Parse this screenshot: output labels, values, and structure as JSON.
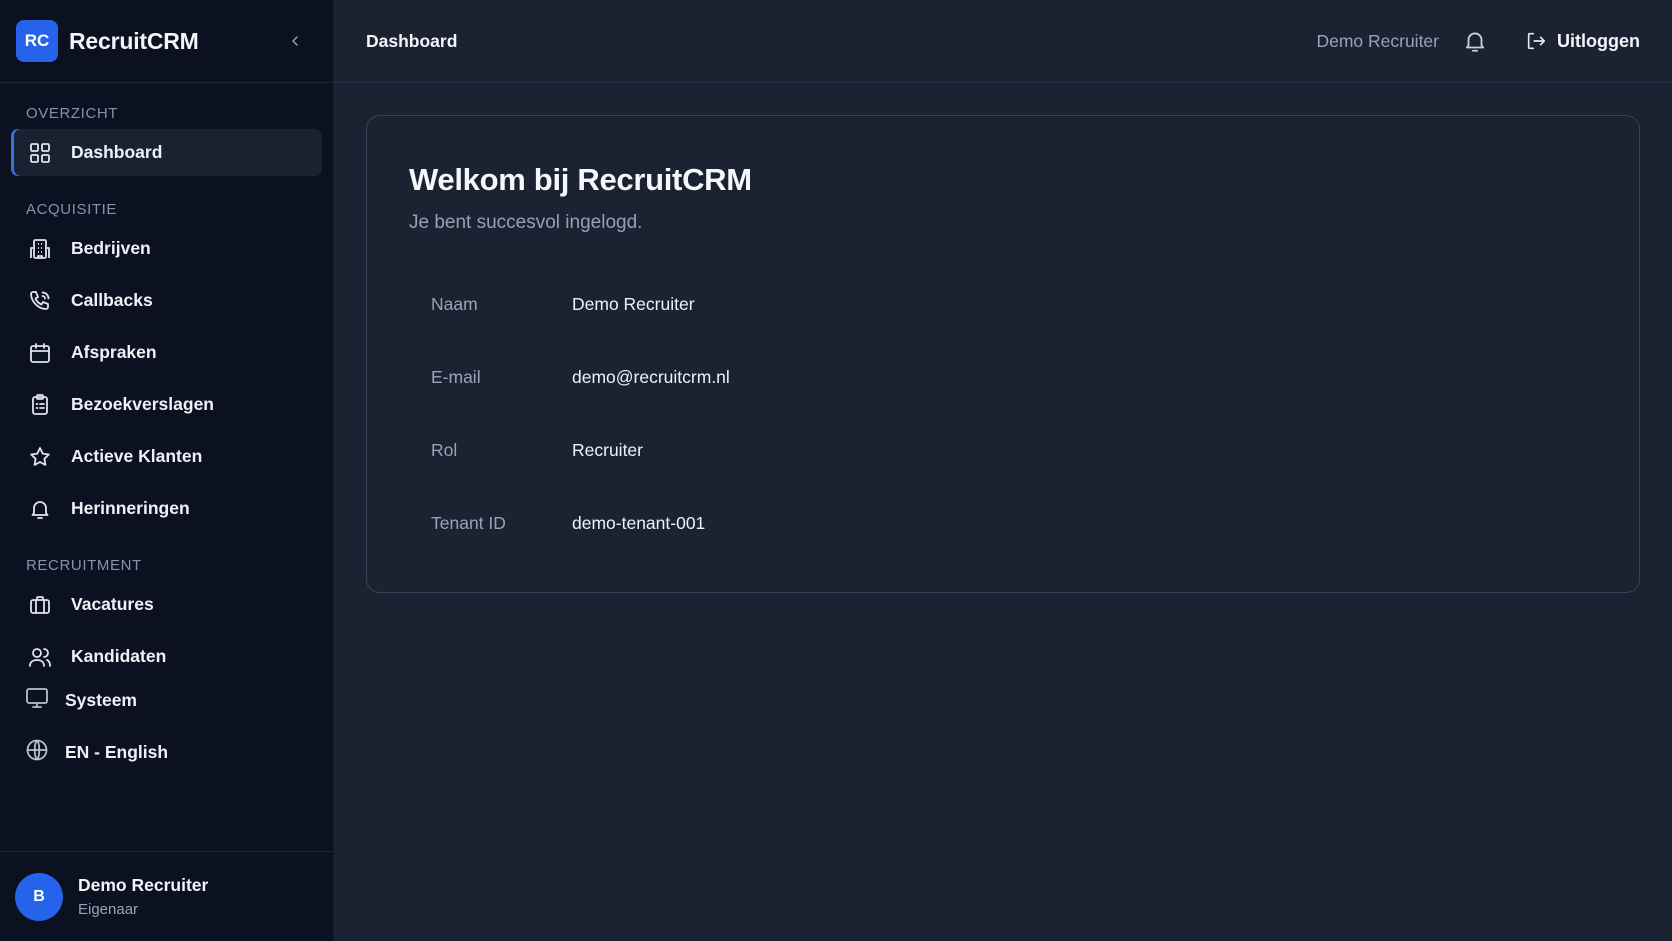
{
  "brand": {
    "logo_text": "RC",
    "name": "RecruitCRM"
  },
  "sidebar": {
    "sections": [
      {
        "title": "OVERZICHT",
        "items": [
          {
            "label": "Dashboard",
            "icon": "grid-icon",
            "active": true
          }
        ]
      },
      {
        "title": "ACQUISITIE",
        "items": [
          {
            "label": "Bedrijven",
            "icon": "building-icon"
          },
          {
            "label": "Callbacks",
            "icon": "phone-icon"
          },
          {
            "label": "Afspraken",
            "icon": "calendar-icon"
          },
          {
            "label": "Bezoekverslagen",
            "icon": "clipboard-icon"
          },
          {
            "label": "Actieve Klanten",
            "icon": "star-icon"
          },
          {
            "label": "Herinneringen",
            "icon": "bell-icon"
          }
        ]
      },
      {
        "title": "RECRUITMENT",
        "items": [
          {
            "label": "Vacatures",
            "icon": "briefcase-icon"
          },
          {
            "label": "Kandidaten",
            "icon": "users-icon"
          }
        ]
      }
    ],
    "bottom_items": {
      "system": "Systeem",
      "language": "EN - English"
    },
    "user": {
      "initial": "B",
      "name": "Demo Recruiter",
      "role": "Eigenaar"
    }
  },
  "topbar": {
    "title": "Dashboard",
    "user_name": "Demo Recruiter",
    "logout_label": "Uitloggen"
  },
  "card": {
    "title": "Welkom bij RecruitCRM",
    "subtitle": "Je bent succesvol ingelogd.",
    "rows": [
      {
        "key": "Naam",
        "value": "Demo Recruiter"
      },
      {
        "key": "E-mail",
        "value": "demo@recruitcrm.nl"
      },
      {
        "key": "Rol",
        "value": "Recruiter"
      },
      {
        "key": "Tenant ID",
        "value": "demo-tenant-001"
      }
    ]
  },
  "colors": {
    "accent": "#2563eb",
    "sidebar_bg": "#0b1120",
    "main_bg": "#1b2333"
  }
}
